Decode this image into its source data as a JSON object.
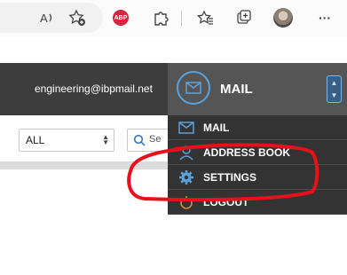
{
  "browser_toolbar": {
    "icons": [
      "read-aloud-icon",
      "add-favorite-icon",
      "adblock-plus-icon",
      "extensions-icon",
      "favorites-icon",
      "collections-icon",
      "profile-avatar",
      "more-icon"
    ],
    "abp_label": "ABP",
    "more_label": "···"
  },
  "app_header": {
    "account_email": "engineering@ibpmail.net"
  },
  "filters": {
    "type_select_value": "ALL",
    "search_placeholder": "Se"
  },
  "menu": {
    "title": "MAIL",
    "items": [
      {
        "label": "MAIL",
        "icon": "envelope-icon"
      },
      {
        "label": "ADDRESS BOOK",
        "icon": "person-icon"
      },
      {
        "label": "SETTINGS",
        "icon": "gear-icon"
      },
      {
        "label": "LOGOUT",
        "icon": "power-icon"
      }
    ]
  },
  "colors": {
    "app_bar": "#3d3d3d",
    "menu_header": "#555555",
    "menu_list": "#333333",
    "accent_blue": "#5aa2dc",
    "annotation_red": "#e8101a"
  }
}
